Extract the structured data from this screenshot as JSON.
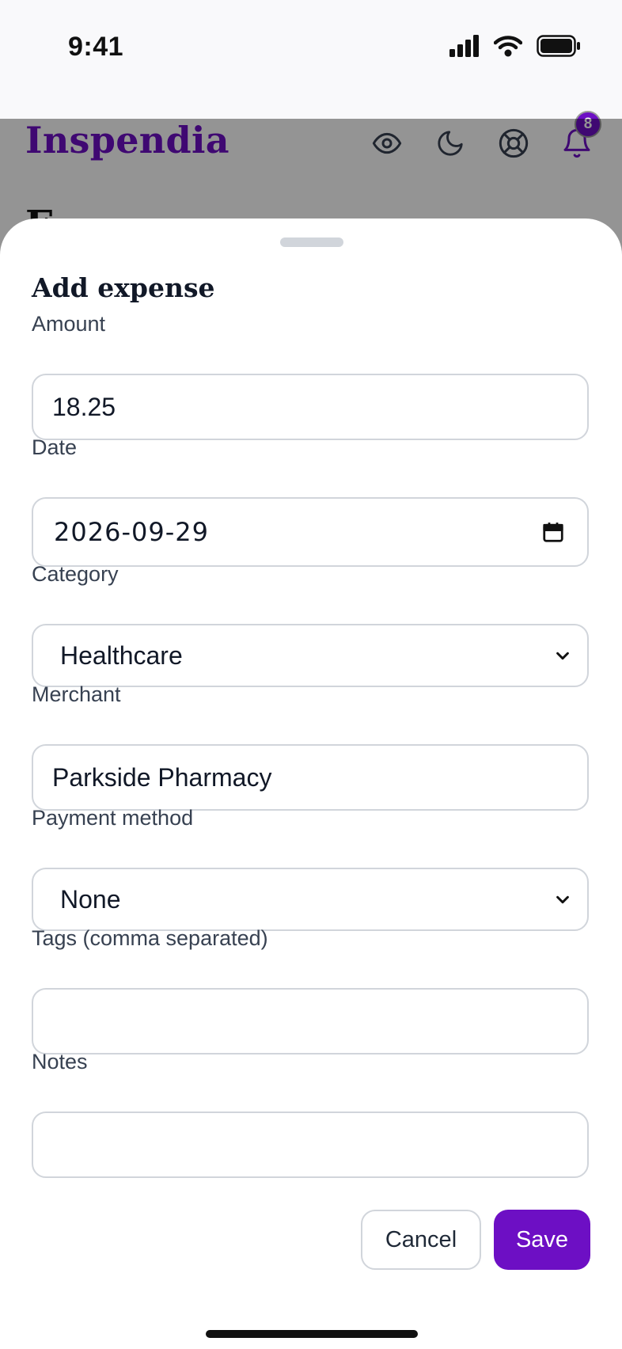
{
  "status_bar": {
    "time": "9:41"
  },
  "app": {
    "brand": "Inspendia",
    "notification_count": "8",
    "page_heading_peek": "E"
  },
  "sheet": {
    "title": "Add expense",
    "fields": {
      "amount": {
        "label": "Amount",
        "value": "18.25"
      },
      "date": {
        "label": "Date",
        "value": "2026-09-29"
      },
      "category": {
        "label": "Category",
        "value": "Healthcare"
      },
      "merchant": {
        "label": "Merchant",
        "value": "Parkside Pharmacy"
      },
      "payment_method": {
        "label": "Payment method",
        "value": "None"
      },
      "tags": {
        "label": "Tags (comma separated)",
        "value": ""
      },
      "notes": {
        "label": "Notes",
        "value": ""
      }
    },
    "buttons": {
      "cancel": "Cancel",
      "save": "Save"
    }
  },
  "colors": {
    "accent": "#6d0fc4",
    "border": "#d1d5db",
    "label": "#374151"
  },
  "icons": [
    "signal-icon",
    "wifi-icon",
    "battery-icon",
    "eye-icon",
    "moon-icon",
    "lifebuoy-icon",
    "bell-icon",
    "calendar-icon",
    "chevron-down-icon"
  ]
}
